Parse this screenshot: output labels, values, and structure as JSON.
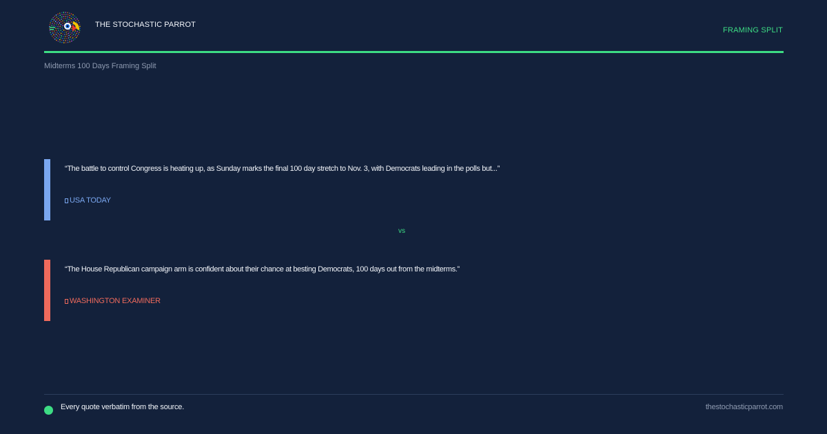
{
  "header": {
    "brand": "THE STOCHASTIC PARROT",
    "tag": "FRAMING SPLIT",
    "logo_icon": "parrot-logo-icon",
    "accent_color": "#3ddc84"
  },
  "subtitle": "Midterms 100 Days Framing Split",
  "quotes": [
    {
      "text": "“The battle to control Congress is heating up, as Sunday marks the final 100 day stretch to Nov. 3, with Democrats leading in the polls but...”",
      "source": "USA TODAY",
      "source_icon": "document-icon",
      "color": "#7aa7f0"
    },
    {
      "text": "“The House Republican campaign arm is confident about their chance at besting Democrats, 100 days out from the midterms.”",
      "source": "WASHINGTON EXAMINER",
      "source_icon": "document-icon",
      "color": "#ee6a5c"
    }
  ],
  "vs": "vs",
  "footer": {
    "note": "Every quote verbatim from the source.",
    "site": "thestochasticparrot.com",
    "dot_color": "#3ddc84"
  }
}
